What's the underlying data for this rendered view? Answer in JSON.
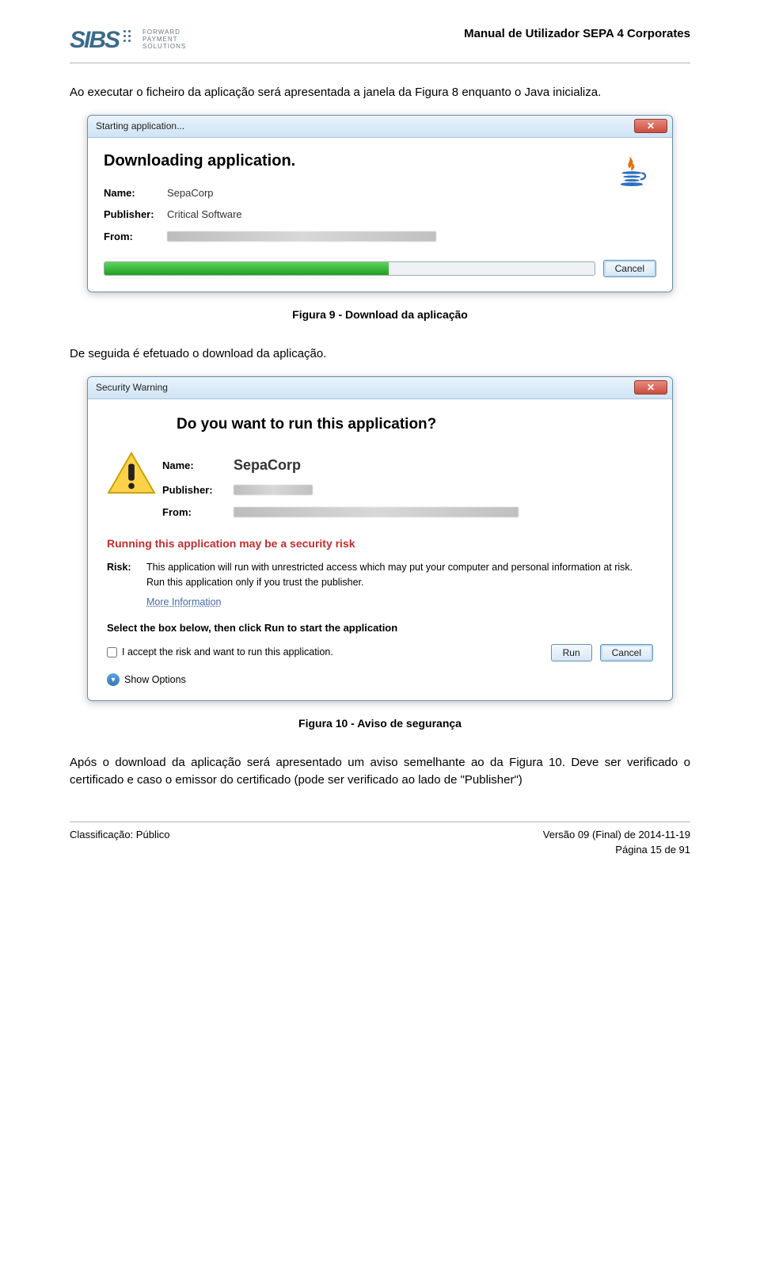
{
  "header": {
    "logo_main": "SIBS",
    "logo_sub_l1": "FORWARD",
    "logo_sub_l2": "PAYMENT",
    "logo_sub_l3": "SOLUTIONS",
    "title": "Manual de Utilizador SEPA 4 Corporates"
  },
  "body": {
    "p1": "Ao executar o ficheiro da aplicação será apresentada a janela da Figura 8 enquanto o Java inicializa.",
    "caption1": "Figura 9 - Download da aplicação",
    "p2": "De seguida é efetuado o download da aplicação.",
    "caption2": "Figura 10 - Aviso de segurança",
    "p3": "Após o download da aplicação será apresentado um aviso semelhante ao da Figura 10. Deve ser verificado o certificado e caso o emissor do certificado (pode ser verificado ao lado de \"Publisher\")"
  },
  "dialog1": {
    "title": "Starting application...",
    "heading": "Downloading application.",
    "name_label": "Name:",
    "name_value": "SepaCorp",
    "publisher_label": "Publisher:",
    "publisher_value": "Critical Software",
    "from_label": "From:",
    "cancel": "Cancel",
    "close": "✕"
  },
  "dialog2": {
    "title": "Security Warning",
    "heading": "Do you want to run this application?",
    "name_label": "Name:",
    "name_value": "SepaCorp",
    "publisher_label": "Publisher:",
    "from_label": "From:",
    "risk_heading": "Running this application may be a security risk",
    "risk_label": "Risk:",
    "risk_text": "This application will run with unrestricted access which may put your computer and personal information at risk. Run this application only if you trust the publisher.",
    "more_info": "More Information",
    "select_line": "Select the box below, then click Run to start the application",
    "accept_text": "I accept the risk and want to run this application.",
    "run": "Run",
    "cancel": "Cancel",
    "show_options": "Show Options",
    "close": "✕"
  },
  "footer": {
    "left": "Classificação: Público",
    "right_l1": "Versão 09 (Final) de 2014-11-19",
    "right_l2": "Página 15 de 91"
  }
}
